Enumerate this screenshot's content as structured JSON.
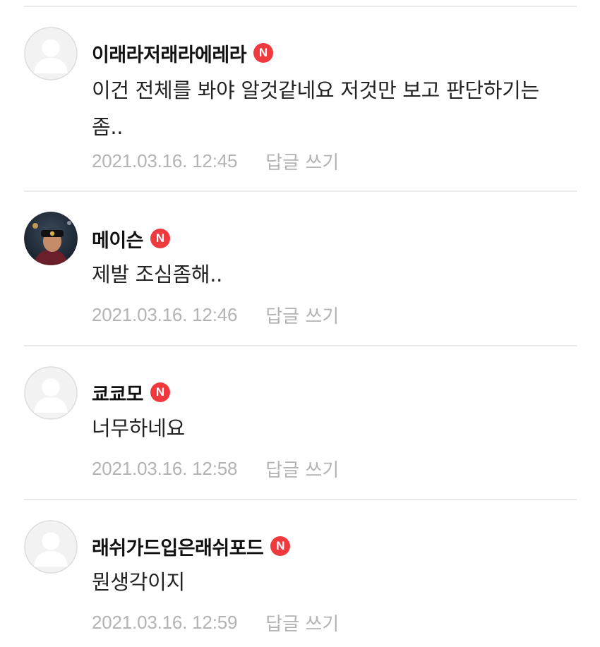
{
  "comments": [
    {
      "author": "이래라저래라에레라",
      "badge": "N",
      "text": "이건 전체를 봐야 알것같네요 저것만 보고 판단하기는 좀..",
      "time": "2021.03.16. 12:45",
      "reply": "답글 쓰기",
      "avatar": "default-avatar"
    },
    {
      "author": "메이슨",
      "badge": "N",
      "text": "제발 조심좀해..",
      "time": "2021.03.16. 12:46",
      "reply": "답글 쓰기",
      "avatar": "photo-avatar"
    },
    {
      "author": "쿄쿄모",
      "badge": "N",
      "text": "너무하네요",
      "time": "2021.03.16. 12:58",
      "reply": "답글 쓰기",
      "avatar": "default-avatar"
    },
    {
      "author": "래쉬가드입은래쉬포드",
      "badge": "N",
      "text": "뭔생각이지",
      "time": "2021.03.16. 12:59",
      "reply": "답글 쓰기",
      "avatar": "default-avatar"
    }
  ],
  "colors": {
    "badge": "#f0383f",
    "meta": "#b3b3b3",
    "divider": "#e9e9e9",
    "author": "#111111",
    "text": "#222222"
  }
}
